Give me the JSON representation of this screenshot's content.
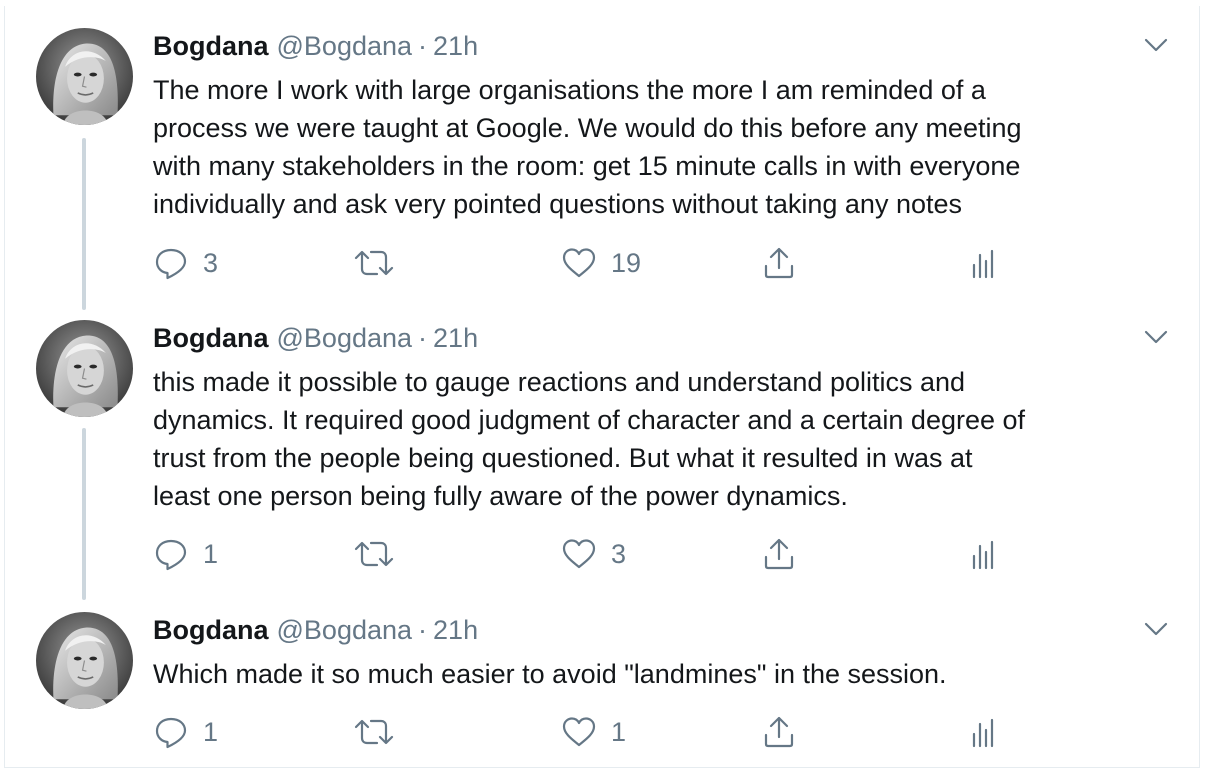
{
  "tweets": [
    {
      "name": "Bogdana",
      "handle": "@Bogdana",
      "separator": "·",
      "time": "21h",
      "text": "The more I work with large organisations the more I am reminded of a\nprocess we were taught at Google. We would do this before any meeting\nwith many stakeholders in the room: get 15 minute calls in with everyone\nindividually and ask very pointed questions without taking any notes",
      "replies": "3",
      "retweets": "",
      "likes": "19"
    },
    {
      "name": "Bogdana",
      "handle": "@Bogdana",
      "separator": "·",
      "time": "21h",
      "text": "this made it possible to gauge reactions and understand politics and\ndynamics. It required good judgment of character and a certain degree of\ntrust from the people being questioned. But what it resulted in was at\nleast one person being fully aware of the power dynamics.",
      "replies": "1",
      "retweets": "",
      "likes": "3"
    },
    {
      "name": "Bogdana",
      "handle": "@Bogdana",
      "separator": "·",
      "time": "21h",
      "text": "Which made it so much easier to avoid \"landmines\" in the session.",
      "replies": "1",
      "retweets": "",
      "likes": "1"
    }
  ],
  "icons": {
    "reply": "reply-icon",
    "retweet": "retweet-icon",
    "like": "heart-icon",
    "share": "share-icon",
    "analytics": "analytics-icon",
    "more": "chevron-down-icon"
  },
  "colors": {
    "text": "#14171a",
    "secondary": "#657786",
    "thread_line": "#ccd6dd"
  }
}
